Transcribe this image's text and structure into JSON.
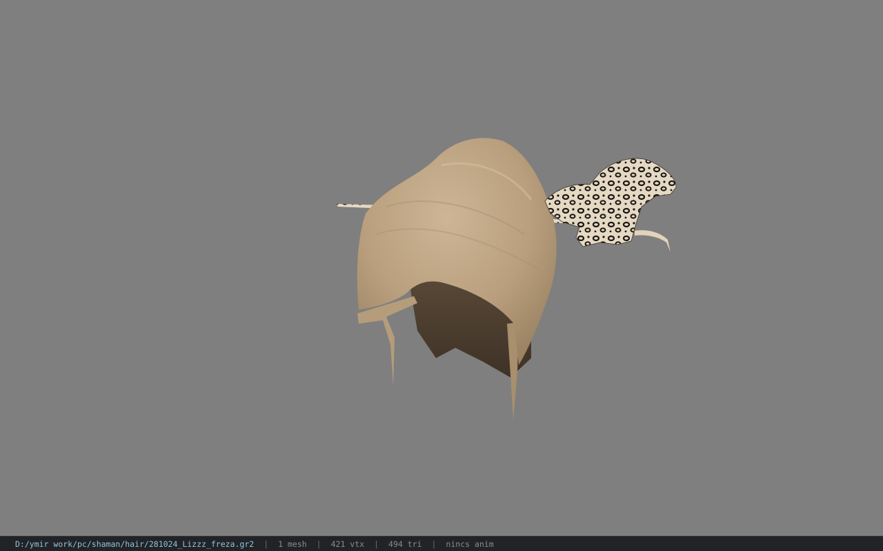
{
  "viewer": {
    "background_color": "#7f7f7f",
    "model": {
      "description_icon": "hair-mesh-with-leopard-bow",
      "base_color": "#c2a987",
      "shadow_color": "#4a3e30",
      "accessory_pattern": "leopard-print"
    }
  },
  "status_bar": {
    "file_path": "D:/ymir work/pc/shaman/hair/281024_Lizzz_freza.gr2",
    "mesh_count": "1 mesh",
    "vertex_count": "421 vtx",
    "triangle_count": "494 tri",
    "animation": "nincs anim",
    "separator": "|"
  }
}
